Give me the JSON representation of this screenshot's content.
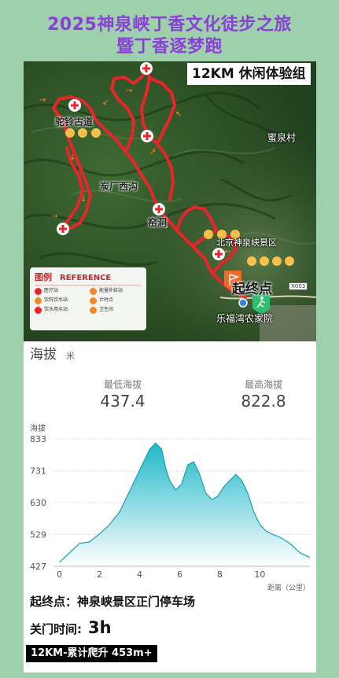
{
  "title": {
    "line1": "2025神泉峡丁香文化徒步之旅",
    "line2": "暨丁香逐梦跑"
  },
  "map": {
    "badge": "12KM 休闲体验组",
    "labels": {
      "tuoling": "驼铃古道",
      "tanchang": "炭厂西沟",
      "yaodong": "窑洞",
      "miquan": "蜜泉村",
      "scenic": "北京神泉峡景区",
      "farmhouse": "乐福湾农家院",
      "start_end": "起终点",
      "road": "X003"
    },
    "legend": {
      "title_cn": "图例",
      "title_en": "REFERENCE",
      "items": [
        "医疗站",
        "能量补给站",
        "饮料饮水站",
        "计时点",
        "饮水用水站",
        "卫生间"
      ]
    },
    "colors": {
      "route": "#e8252b",
      "title": "#8a3fd6",
      "chart_fill": "#1fb8c8"
    }
  },
  "elevation": {
    "title": "海拔",
    "unit": "米",
    "min_label": "最低海拔",
    "min_value": "437.4",
    "max_label": "最高海拔",
    "max_value": "822.8"
  },
  "chart_data": {
    "type": "area",
    "ylabel": "海拔",
    "xlabel": "距离（公里）",
    "y_ticks": [
      "427",
      "529",
      "630",
      "731",
      "833"
    ],
    "x_ticks": [
      "0",
      "2",
      "4",
      "6",
      "8",
      "10"
    ],
    "ylim": [
      427,
      833
    ],
    "xlim": [
      -0.3,
      12.5
    ],
    "x": [
      0,
      0.5,
      1,
      1.5,
      2,
      2.5,
      3,
      3.3,
      3.6,
      3.9,
      4.2,
      4.5,
      4.8,
      5.1,
      5.3,
      5.5,
      5.8,
      6.1,
      6.4,
      6.7,
      7.0,
      7.3,
      7.6,
      7.9,
      8.2,
      8.5,
      8.8,
      9.1,
      9.4,
      9.7,
      10,
      10.3,
      10.6,
      11,
      11.5,
      12,
      12.5
    ],
    "y": [
      440,
      470,
      500,
      505,
      530,
      560,
      600,
      640,
      680,
      720,
      760,
      800,
      820,
      800,
      740,
      700,
      670,
      690,
      750,
      760,
      720,
      660,
      640,
      650,
      680,
      700,
      720,
      700,
      660,
      600,
      560,
      540,
      530,
      520,
      500,
      470,
      455
    ],
    "grid": true
  },
  "info": {
    "start_label": "起终点：神泉峡景区正门停车场",
    "close_label": "关门时间:",
    "close_value": "3h",
    "climb": "12KM-累计爬升 453m+"
  }
}
